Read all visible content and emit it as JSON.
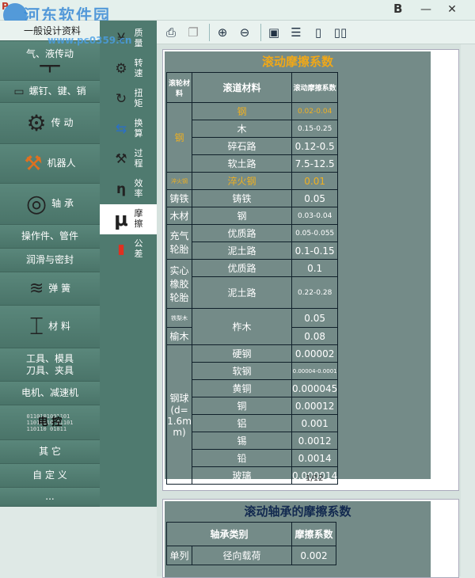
{
  "titlebar": {
    "logo": "P",
    "watermark": "河东软件园",
    "watermark_url": "www.pc0359.cn",
    "b_label": "B",
    "minimize": "—",
    "close": "✕"
  },
  "left": {
    "header": "一般设计资料",
    "categories": [
      {
        "label": "气、液传动",
        "icon": "cylinder-icon"
      },
      {
        "label": "螺钉、键、销",
        "icon": "key-icon"
      },
      {
        "label": "传 动",
        "icon": "gear-icon"
      },
      {
        "label": "机器人",
        "icon": "robot-icon"
      },
      {
        "label": "轴 承",
        "icon": "bearing-icon"
      },
      {
        "label": "操作件、管件",
        "icon": ""
      },
      {
        "label": "润滑与密封",
        "icon": ""
      },
      {
        "label": "弹 簧",
        "icon": "spring-icon"
      },
      {
        "label": "材 料",
        "icon": "beam-icon"
      },
      {
        "label": "工具、模具\n刀具、夹具",
        "icon": ""
      },
      {
        "label": "电机、减速机",
        "icon": ""
      },
      {
        "label": "电 控",
        "icon": "binary-icon"
      },
      {
        "label": "其 它",
        "icon": ""
      },
      {
        "label": "自 定 义",
        "icon": ""
      },
      {
        "label": "...",
        "icon": ""
      }
    ]
  },
  "mid": {
    "items": [
      {
        "l1": "质",
        "l2": "量",
        "icon": "¥"
      },
      {
        "l1": "转",
        "l2": "速",
        "icon": "⚙"
      },
      {
        "l1": "扭",
        "l2": "矩",
        "icon": "↻"
      },
      {
        "l1": "换",
        "l2": "算",
        "icon": "⇆"
      },
      {
        "l1": "过",
        "l2": "程",
        "icon": "⚒"
      },
      {
        "l1": "效",
        "l2": "率",
        "icon": "η"
      },
      {
        "l1": "摩",
        "l2": "擦",
        "icon": "μ"
      },
      {
        "l1": "公",
        "l2": "差",
        "icon": "▮"
      }
    ]
  },
  "doc": {
    "page_number": "1/12",
    "table1": {
      "title": "滚动摩擦系数",
      "headers": [
        "滚轮材料",
        "滚道材料",
        "滚动摩擦系数"
      ],
      "rows": [
        {
          "wheel": "钢",
          "track": "钢",
          "coef": "0.02-0.04"
        },
        {
          "track": "木",
          "coef": "0.15-0.25"
        },
        {
          "track": "碎石路",
          "coef": "0.12-0.5"
        },
        {
          "track": "软土路",
          "coef": "7.5-12.5"
        },
        {
          "wheel": "淬火钢",
          "track": "淬火钢",
          "coef": "0.01"
        },
        {
          "wheel": "铸铁",
          "track": "铸铁",
          "coef": "0.05"
        },
        {
          "wheel": "木材",
          "track": "钢",
          "coef": "0.03-0.04"
        },
        {
          "wheel": "充气轮胎",
          "track": "优质路",
          "coef": "0.05-0.055"
        },
        {
          "track": "泥土路",
          "coef": "0.1-0.15"
        },
        {
          "wheel": "实心橡胶轮胎",
          "track": "优质路",
          "coef": "0.1"
        },
        {
          "track": "泥土路",
          "coef": "0.22-0.28"
        },
        {
          "wheel": "铁梨木",
          "track": "柞木",
          "coef": "0.05"
        },
        {
          "wheel": "榆木",
          "coef": "0.08"
        },
        {
          "wheel": "钢球(d=1.6mm)",
          "track": "硬钢",
          "coef": "0.00002"
        },
        {
          "track": "软钢",
          "coef": "0.00004-0.0001"
        },
        {
          "track": "黄铜",
          "coef": "0.000045"
        },
        {
          "track": "铜",
          "coef": "0.00012"
        },
        {
          "track": "铝",
          "coef": "0.001"
        },
        {
          "track": "锡",
          "coef": "0.0012"
        },
        {
          "track": "铅",
          "coef": "0.0014"
        },
        {
          "track": "玻璃",
          "coef": "0.000014"
        }
      ]
    },
    "table2": {
      "title": "滚动轴承的摩擦系数",
      "headers": [
        "轴承类别",
        "摩擦系数"
      ],
      "row1": {
        "c1": "单列",
        "c2": "径向载荷",
        "c3": "0.002"
      }
    }
  }
}
